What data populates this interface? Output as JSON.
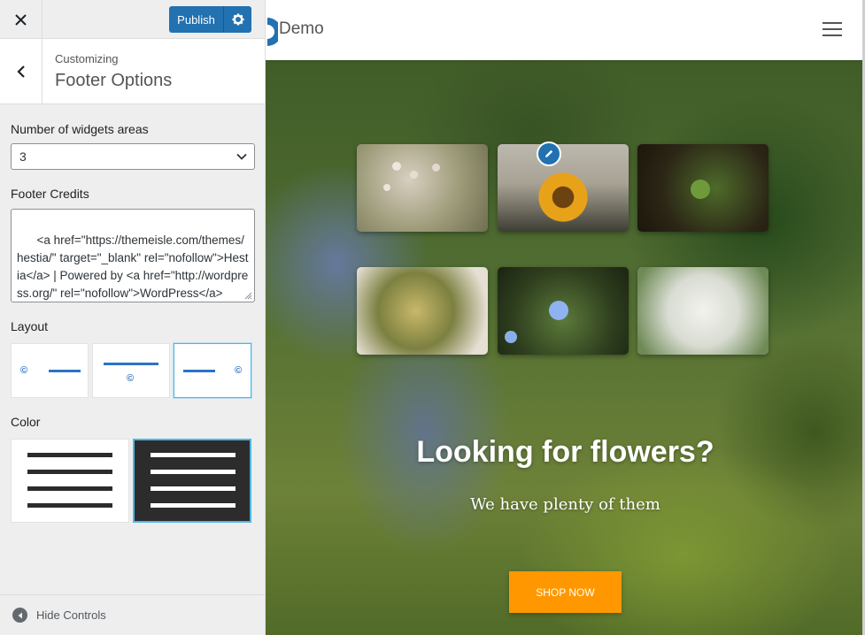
{
  "customizer": {
    "close_icon": "close-icon",
    "publish_label": "Publish",
    "settings_icon": "gear-icon",
    "breadcrumb": "Customizing",
    "section_title": "Footer Options",
    "back_icon": "chevron-left-icon"
  },
  "controls": {
    "widgets": {
      "label": "Number of widgets areas",
      "value": "3"
    },
    "credits": {
      "label": "Footer Credits",
      "value": "<a href=\"https://themeisle.com/themes/hestia/\" target=\"_blank\" rel=\"nofollow\">Hestia</a> | Powered by <a href=\"http://wordpress.org/\" rel=\"nofollow\">WordPress</a>"
    },
    "layout": {
      "label": "Layout",
      "options": [
        "copyright-left",
        "copyright-center",
        "copyright-right"
      ],
      "selected": "copyright-right"
    },
    "color": {
      "label": "Color",
      "options": [
        "light",
        "dark"
      ],
      "selected": "dark"
    }
  },
  "footer_bar": {
    "hide_label": "Hide Controls"
  },
  "preview": {
    "site_name": "Demo",
    "menu_icon": "hamburger-menu-icon",
    "hero_title": "Looking for flowers?",
    "hero_subtitle": "We have plenty of them",
    "cta_label": "SHOP NOW",
    "edit_icon": "pencil-icon"
  },
  "colors": {
    "publish_blue": "#2271b1",
    "cta_orange": "#ff9800",
    "selection_blue": "#4fb4e6"
  }
}
